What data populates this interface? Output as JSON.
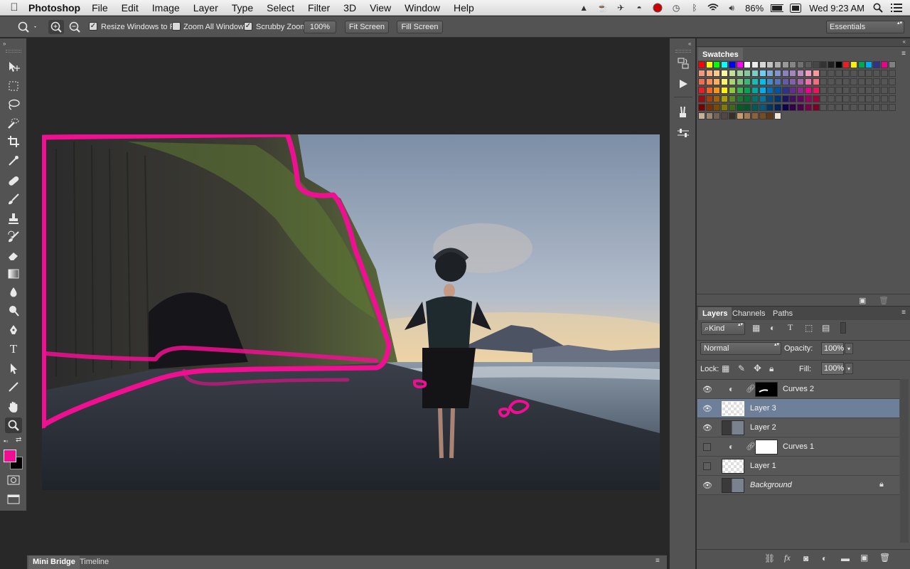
{
  "menubar": {
    "app_name": "Photoshop",
    "items": [
      "File",
      "Edit",
      "Image",
      "Layer",
      "Type",
      "Select",
      "Filter",
      "3D",
      "View",
      "Window",
      "Help"
    ],
    "battery": "86%",
    "clock": "Wed 9:23 AM",
    "status_icons": [
      "google-drive-icon",
      "cup-icon",
      "crane-icon",
      "bowler-hat-icon",
      "record-icon",
      "time-machine-icon",
      "bluetooth-icon",
      "wifi-icon",
      "volume-icon",
      "battery-icon",
      "keyboard-icon",
      "spotlight-icon",
      "notification-list-icon"
    ]
  },
  "options": {
    "resize_windows": "Resize Windows to Fit",
    "resize_checked": true,
    "zoom_all": "Zoom All Windows",
    "zoom_all_checked": false,
    "scrubby": "Scrubby Zoom",
    "scrubby_checked": true,
    "zoom_value": "100%",
    "fit_screen": "Fit Screen",
    "fill_screen": "Fill Screen",
    "workspace": "Essentials"
  },
  "colors": {
    "foreground": "#ee1090",
    "background": "#000000",
    "selection_marker": "#ee1090",
    "selected_layer": "#6d7f99"
  },
  "swatches": {
    "title": "Swatches"
  },
  "layers_panel": {
    "tabs": [
      "Layers",
      "Channels",
      "Paths"
    ],
    "filter_kind": "Kind",
    "blend_mode": "Normal",
    "opacity_label": "Opacity:",
    "opacity": "100%",
    "lock_label": "Lock:",
    "fill_label": "Fill:",
    "fill": "100%",
    "layers": [
      {
        "name": "Curves 2",
        "visible": true,
        "type": "adjustment",
        "selected": false
      },
      {
        "name": "Layer 3",
        "visible": true,
        "type": "pixel-transparent",
        "selected": true
      },
      {
        "name": "Layer 2",
        "visible": true,
        "type": "pixel-image",
        "selected": false
      },
      {
        "name": "Curves 1",
        "visible": false,
        "type": "adjustment",
        "selected": false
      },
      {
        "name": "Layer 1",
        "visible": false,
        "type": "pixel-transparent",
        "selected": false
      },
      {
        "name": "Background",
        "visible": true,
        "type": "background",
        "selected": false
      }
    ]
  },
  "bottom_tabs": [
    "Mini Bridge",
    "Timeline"
  ]
}
